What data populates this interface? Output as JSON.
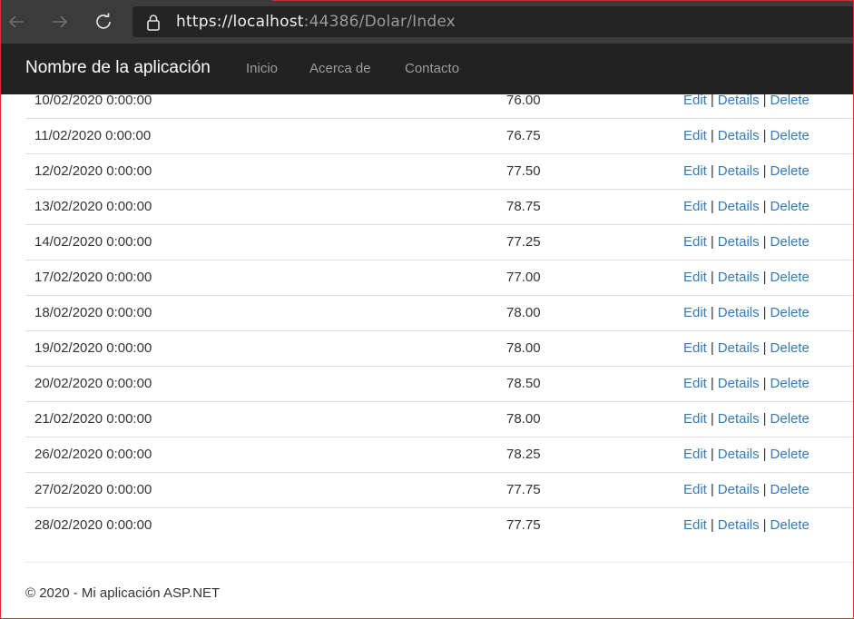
{
  "browser": {
    "url_host": "https://localhost",
    "url_rest": ":44386/Dolar/Index"
  },
  "navbar": {
    "brand": "Nombre de la aplicación",
    "links": [
      "Inicio",
      "Acerca de",
      "Contacto"
    ]
  },
  "table": {
    "actions": {
      "edit": "Edit",
      "details": "Details",
      "delete": "Delete",
      "separator": "|"
    },
    "rows": [
      {
        "date": "10/02/2020 0:00:00",
        "value": "76.00"
      },
      {
        "date": "11/02/2020 0:00:00",
        "value": "76.75"
      },
      {
        "date": "12/02/2020 0:00:00",
        "value": "77.50"
      },
      {
        "date": "13/02/2020 0:00:00",
        "value": "78.75"
      },
      {
        "date": "14/02/2020 0:00:00",
        "value": "77.25"
      },
      {
        "date": "17/02/2020 0:00:00",
        "value": "77.00"
      },
      {
        "date": "18/02/2020 0:00:00",
        "value": "78.00"
      },
      {
        "date": "19/02/2020 0:00:00",
        "value": "78.00"
      },
      {
        "date": "20/02/2020 0:00:00",
        "value": "78.50"
      },
      {
        "date": "21/02/2020 0:00:00",
        "value": "78.00"
      },
      {
        "date": "26/02/2020 0:00:00",
        "value": "78.25"
      },
      {
        "date": "27/02/2020 0:00:00",
        "value": "77.75"
      },
      {
        "date": "28/02/2020 0:00:00",
        "value": "77.75"
      }
    ]
  },
  "footer": {
    "text": "© 2020 - Mi aplicación ASP.NET"
  },
  "colors": {
    "link": "#337ab7",
    "navbar": "#222222",
    "browser_bar": "#3b3b3b"
  }
}
